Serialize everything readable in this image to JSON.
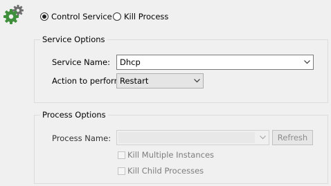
{
  "mode": {
    "control_service_label": "Control Service",
    "kill_process_label": "Kill Process",
    "selected": "control_service"
  },
  "service_options": {
    "title": "Service Options",
    "service_name_label": "Service Name:",
    "service_name_value": "Dhcp",
    "action_label": "Action to perform:",
    "action_value": "Restart"
  },
  "process_options": {
    "title": "Process Options",
    "process_name_label": "Process Name:",
    "process_name_value": "",
    "refresh_label": "Refresh",
    "kill_multiple_label": "Kill Multiple Instances",
    "kill_children_label": "Kill Child Processes"
  },
  "icons": {
    "logo": "gears-icon",
    "dropdown": "chevron-down-icon"
  },
  "colors": {
    "logo_green": "#3f8f3c",
    "logo_gray": "#6f6f6f"
  }
}
